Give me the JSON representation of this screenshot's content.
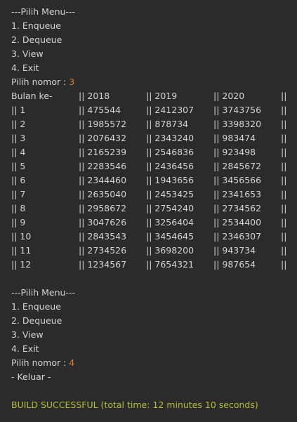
{
  "menu1": {
    "title": "---Pilih Menu---",
    "items": [
      "1. Enqueue",
      "2. Dequeue",
      "3. View",
      "4. Exit"
    ],
    "prompt": "Pilih nomor : ",
    "choice": "3"
  },
  "table": {
    "header": [
      "Bulan ke-",
      "|| 2018",
      "|| 2019",
      "|| 2020",
      "||"
    ],
    "rows": [
      [
        "|| 1",
        "|| 475544",
        "|| 2412307",
        "|| 3743756",
        "||"
      ],
      [
        "|| 2",
        "|| 1985572",
        "|| 878734",
        "|| 3398320",
        "||"
      ],
      [
        "|| 3",
        "|| 2076432",
        "|| 2343240",
        "|| 983474",
        "||"
      ],
      [
        "|| 4",
        "|| 2165239",
        "|| 2546836",
        "|| 923498",
        "||"
      ],
      [
        "|| 5",
        "|| 2283546",
        "|| 2436456",
        "|| 2845672",
        "||"
      ],
      [
        "|| 6",
        "|| 2344460",
        "|| 1943656",
        "|| 3456566",
        "||"
      ],
      [
        "|| 7",
        "|| 2635040",
        "|| 2453425",
        "|| 2341653",
        "||"
      ],
      [
        "|| 8",
        "|| 2958672",
        "|| 2754240",
        "|| 2734562",
        "||"
      ],
      [
        "|| 9",
        "|| 3047626",
        "|| 3256404",
        "|| 2534400",
        "||"
      ],
      [
        "|| 10",
        "|| 2843543",
        "|| 3454645",
        "|| 2346307",
        "||"
      ],
      [
        "|| 11",
        "|| 2734526",
        "|| 3698200",
        "|| 943734",
        "||"
      ],
      [
        "|| 12",
        "|| 1234567",
        "|| 7654321",
        "|| 987654",
        "||"
      ]
    ]
  },
  "menu2": {
    "title": "---Pilih Menu---",
    "items": [
      "1. Enqueue",
      "2. Dequeue",
      "3. View",
      "4. Exit"
    ],
    "prompt": "Pilih nomor : ",
    "choice": "4",
    "exit_message": "- Keluar -"
  },
  "build_status": "BUILD SUCCESSFUL (total time: 12 minutes 10 seconds)",
  "colors": {
    "background": "#2b2b2b",
    "text": "#d4d4d4",
    "input_number": "#e07b39",
    "build_success": "#b5bd3b"
  }
}
